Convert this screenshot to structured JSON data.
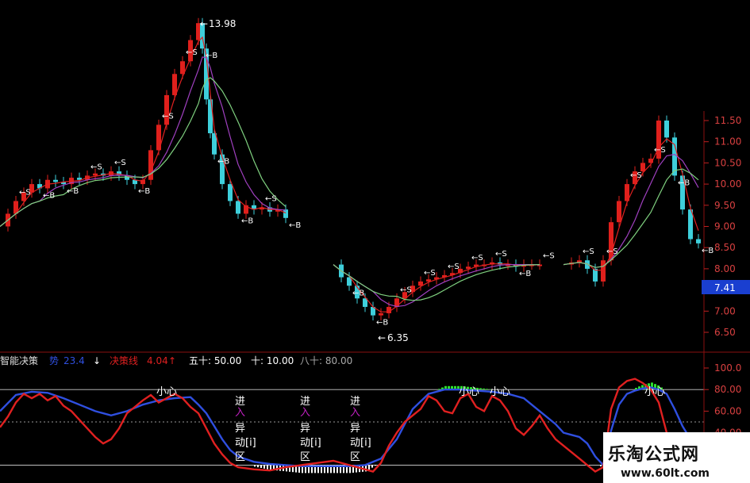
{
  "price_panel": {
    "y_ticks": [
      "11.50",
      "11.00",
      "10.50",
      "10.00",
      "9.50",
      "9.00",
      "8.50",
      "8.00",
      "7.50",
      "7.00",
      "6.50"
    ],
    "y_values": [
      11.5,
      11.0,
      10.5,
      10.0,
      9.5,
      9.0,
      8.5,
      8.0,
      7.5,
      7.0,
      6.5
    ],
    "current_price": "7.41",
    "high_marker": "13.98",
    "low_marker": "6.35",
    "signal_buy": "B",
    "signal_sell": "S",
    "colors": {
      "up": "#e0201c",
      "down": "#3ecfdb",
      "ma_short": "#e02020",
      "ma_mid": "#a040c0",
      "ma_long": "#7fd07f",
      "grid": "#7a1010"
    }
  },
  "indicator_header": {
    "name": "智能决策",
    "line1_label": "势",
    "line1_value": "23.4",
    "line1_arrow": "↓",
    "line2_label": "决策线",
    "line2_value": "4.04",
    "line2_arrow": "↑",
    "level_50": "五十: 50.00",
    "level_10": "十: 10.00",
    "level_80": "八十: 80.00"
  },
  "indicator_panel": {
    "y_ticks": [
      "100.0",
      "80.00",
      "60.00",
      "40.00"
    ],
    "annotations": {
      "caution": "小心",
      "entry_chars": [
        "进",
        "入"
      ],
      "anomaly_chars": [
        "异",
        "动[i]",
        "区"
      ]
    }
  },
  "watermark": {
    "title": "乐淘公式网",
    "url": "www.60lt.com"
  },
  "chart_data": {
    "type": "line",
    "title": "",
    "ylim_price": [
      6.2,
      11.8
    ],
    "ylim_indicator": [
      0,
      105
    ],
    "price_markers": {
      "high": 13.98,
      "low": 6.35,
      "last": 7.41
    },
    "price_close": [
      [
        0,
        9.0
      ],
      [
        10,
        9.3
      ],
      [
        20,
        9.6
      ],
      [
        30,
        9.8
      ],
      [
        40,
        10.0
      ],
      [
        50,
        9.9
      ],
      [
        60,
        10.1
      ],
      [
        70,
        10.05
      ],
      [
        80,
        10.0
      ],
      [
        90,
        10.15
      ],
      [
        100,
        10.1
      ],
      [
        110,
        10.2
      ],
      [
        120,
        10.25
      ],
      [
        130,
        10.2
      ],
      [
        140,
        10.3
      ],
      [
        150,
        10.2
      ],
      [
        160,
        10.1
      ],
      [
        170,
        10.0
      ],
      [
        180,
        10.1
      ],
      [
        190,
        10.8
      ],
      [
        200,
        11.4
      ],
      [
        210,
        12.1
      ],
      [
        220,
        12.6
      ],
      [
        230,
        12.9
      ],
      [
        240,
        13.4
      ],
      [
        250,
        13.8
      ],
      [
        255,
        13.2
      ],
      [
        260,
        12.0
      ],
      [
        265,
        11.2
      ],
      [
        270,
        10.7
      ],
      [
        280,
        10.0
      ],
      [
        290,
        9.6
      ],
      [
        300,
        9.3
      ],
      [
        310,
        9.5
      ],
      [
        320,
        9.4
      ],
      [
        330,
        9.45
      ],
      [
        340,
        9.35
      ],
      [
        350,
        9.4
      ],
      [
        360,
        9.2
      ],
      [
        420,
        8.1
      ],
      [
        430,
        7.8
      ],
      [
        440,
        7.6
      ],
      [
        450,
        7.3
      ],
      [
        460,
        7.1
      ],
      [
        470,
        6.9
      ],
      [
        480,
        6.95
      ],
      [
        490,
        7.1
      ],
      [
        500,
        7.3
      ],
      [
        510,
        7.45
      ],
      [
        520,
        7.6
      ],
      [
        530,
        7.7
      ],
      [
        540,
        7.75
      ],
      [
        550,
        7.8
      ],
      [
        560,
        7.85
      ],
      [
        570,
        7.9
      ],
      [
        580,
        8.0
      ],
      [
        590,
        8.05
      ],
      [
        600,
        8.1
      ],
      [
        610,
        8.1
      ],
      [
        620,
        8.15
      ],
      [
        630,
        8.1
      ],
      [
        640,
        8.1
      ],
      [
        650,
        8.05
      ],
      [
        660,
        8.1
      ],
      [
        670,
        8.1
      ],
      [
        680,
        8.1
      ],
      [
        710,
        8.1
      ],
      [
        720,
        8.15
      ],
      [
        730,
        8.2
      ],
      [
        740,
        8.0
      ],
      [
        750,
        7.7
      ],
      [
        760,
        8.2
      ],
      [
        770,
        9.1
      ],
      [
        780,
        9.6
      ],
      [
        790,
        10.0
      ],
      [
        800,
        10.3
      ],
      [
        810,
        10.5
      ],
      [
        820,
        10.6
      ],
      [
        830,
        11.5
      ],
      [
        840,
        11.1
      ],
      [
        850,
        10.2
      ],
      [
        860,
        9.4
      ],
      [
        870,
        8.7
      ],
      [
        880,
        8.6
      ]
    ],
    "series": [
      {
        "name": "势",
        "color": "#2f4fe0",
        "points": [
          [
            0,
            60
          ],
          [
            20,
            75
          ],
          [
            40,
            78
          ],
          [
            60,
            77
          ],
          [
            80,
            72
          ],
          [
            100,
            66
          ],
          [
            120,
            60
          ],
          [
            140,
            56
          ],
          [
            160,
            60
          ],
          [
            180,
            66
          ],
          [
            200,
            70
          ],
          [
            220,
            72
          ],
          [
            240,
            73
          ],
          [
            250,
            66
          ],
          [
            260,
            58
          ],
          [
            270,
            46
          ],
          [
            280,
            34
          ],
          [
            290,
            24
          ],
          [
            300,
            18
          ],
          [
            320,
            13
          ],
          [
            340,
            11
          ],
          [
            360,
            10
          ],
          [
            380,
            9
          ],
          [
            400,
            9
          ],
          [
            420,
            9
          ],
          [
            440,
            9
          ],
          [
            460,
            10
          ],
          [
            480,
            16
          ],
          [
            500,
            34
          ],
          [
            520,
            62
          ],
          [
            540,
            76
          ],
          [
            560,
            80
          ],
          [
            580,
            80
          ],
          [
            600,
            79
          ],
          [
            620,
            78
          ],
          [
            640,
            76
          ],
          [
            660,
            72
          ],
          [
            680,
            60
          ],
          [
            700,
            48
          ],
          [
            710,
            40
          ],
          [
            720,
            38
          ],
          [
            730,
            36
          ],
          [
            740,
            30
          ],
          [
            750,
            18
          ],
          [
            760,
            10
          ],
          [
            770,
            42
          ],
          [
            780,
            66
          ],
          [
            790,
            76
          ],
          [
            800,
            79
          ],
          [
            810,
            81
          ],
          [
            820,
            82
          ],
          [
            830,
            80
          ],
          [
            840,
            76
          ],
          [
            850,
            62
          ],
          [
            860,
            46
          ],
          [
            870,
            34
          ]
        ]
      },
      {
        "name": "决策线",
        "color": "#e02020",
        "points": [
          [
            0,
            45
          ],
          [
            10,
            55
          ],
          [
            20,
            68
          ],
          [
            30,
            76
          ],
          [
            40,
            72
          ],
          [
            50,
            76
          ],
          [
            60,
            70
          ],
          [
            70,
            74
          ],
          [
            80,
            65
          ],
          [
            90,
            60
          ],
          [
            100,
            52
          ],
          [
            110,
            44
          ],
          [
            120,
            36
          ],
          [
            130,
            30
          ],
          [
            140,
            34
          ],
          [
            150,
            44
          ],
          [
            160,
            58
          ],
          [
            170,
            64
          ],
          [
            180,
            70
          ],
          [
            190,
            75
          ],
          [
            200,
            68
          ],
          [
            210,
            72
          ],
          [
            220,
            76
          ],
          [
            230,
            72
          ],
          [
            240,
            64
          ],
          [
            250,
            58
          ],
          [
            260,
            44
          ],
          [
            270,
            30
          ],
          [
            280,
            20
          ],
          [
            290,
            12
          ],
          [
            300,
            8
          ],
          [
            320,
            6
          ],
          [
            340,
            5
          ],
          [
            360,
            8
          ],
          [
            380,
            10
          ],
          [
            400,
            12
          ],
          [
            420,
            14
          ],
          [
            440,
            10
          ],
          [
            460,
            6
          ],
          [
            470,
            4
          ],
          [
            480,
            12
          ],
          [
            490,
            28
          ],
          [
            500,
            40
          ],
          [
            510,
            50
          ],
          [
            520,
            56
          ],
          [
            530,
            62
          ],
          [
            540,
            74
          ],
          [
            550,
            70
          ],
          [
            560,
            60
          ],
          [
            570,
            58
          ],
          [
            580,
            72
          ],
          [
            590,
            76
          ],
          [
            600,
            64
          ],
          [
            610,
            60
          ],
          [
            620,
            74
          ],
          [
            630,
            70
          ],
          [
            640,
            60
          ],
          [
            650,
            44
          ],
          [
            660,
            38
          ],
          [
            670,
            46
          ],
          [
            680,
            56
          ],
          [
            690,
            44
          ],
          [
            700,
            34
          ],
          [
            710,
            28
          ],
          [
            720,
            22
          ],
          [
            730,
            16
          ],
          [
            740,
            10
          ],
          [
            750,
            4
          ],
          [
            760,
            8
          ],
          [
            770,
            62
          ],
          [
            780,
            82
          ],
          [
            790,
            88
          ],
          [
            800,
            90
          ],
          [
            810,
            86
          ],
          [
            820,
            80
          ],
          [
            830,
            68
          ],
          [
            840,
            40
          ],
          [
            850,
            22
          ],
          [
            860,
            8
          ]
        ]
      }
    ],
    "levels": [
      50,
      10,
      80
    ]
  }
}
